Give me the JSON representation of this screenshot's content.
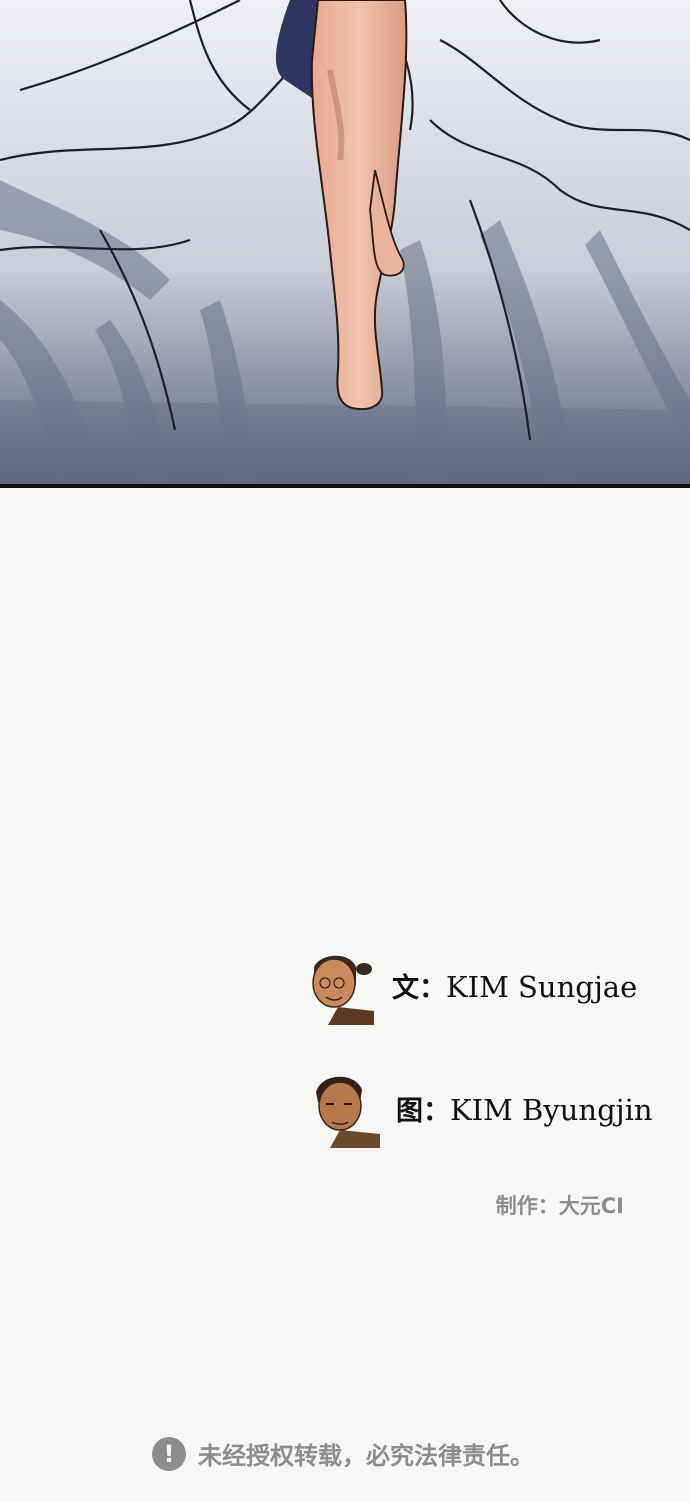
{
  "credits": {
    "writer_label": "文：",
    "writer_name": "KIM Sungjae",
    "artist_label": "图：",
    "artist_name": "KIM Byungjin",
    "production": "制作：大元CI"
  },
  "notice": {
    "icon": "exclamation-icon",
    "text": "未经授权转载，必究法律责任。"
  },
  "colors": {
    "background": "#f7f7f6",
    "muted_text": "#8d8d8d",
    "sheet_shadow": "#4a5068",
    "skin": "#e6b29a"
  }
}
